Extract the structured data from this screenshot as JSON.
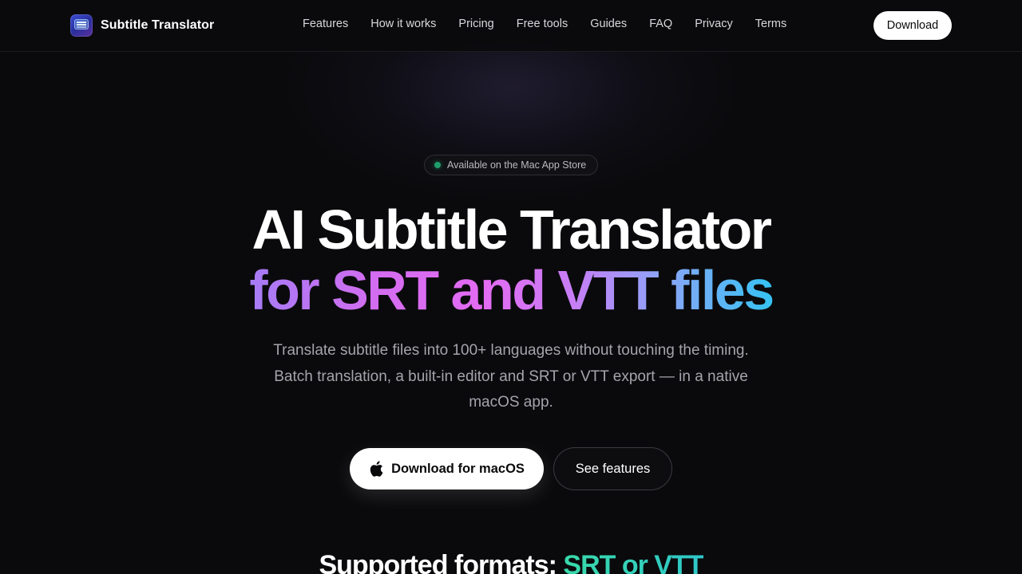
{
  "header": {
    "brand_name": "Subtitle Translator",
    "nav": [
      "Features",
      "How it works",
      "Pricing",
      "Free tools",
      "Guides",
      "FAQ",
      "Privacy",
      "Terms"
    ],
    "download_label": "Download"
  },
  "hero": {
    "badge": "Available on the Mac App Store",
    "title_line1": "AI Subtitle Translator",
    "title_line2": "for SRT and VTT files",
    "subtitle": "Translate subtitle files into 100+ languages without touching the timing. Batch translation, a built-in editor and SRT or VTT export — in a native macOS app.",
    "cta_primary": "Download for macOS",
    "cta_secondary": "See features"
  },
  "formats_section": {
    "title_prefix": "Supported formats:",
    "title_highlight": "SRT or VTT"
  },
  "colors": {
    "background": "#0a0a0c",
    "accent_gradient": [
      "#a57cf5",
      "#e36bf2",
      "#35c3f3"
    ],
    "status_dot": "#1f9d6b",
    "teal_highlight": "#38d9a9"
  },
  "icons": {
    "logo": "subtitle-app-icon",
    "cta_primary": "apple-icon",
    "badge": "status-dot"
  }
}
